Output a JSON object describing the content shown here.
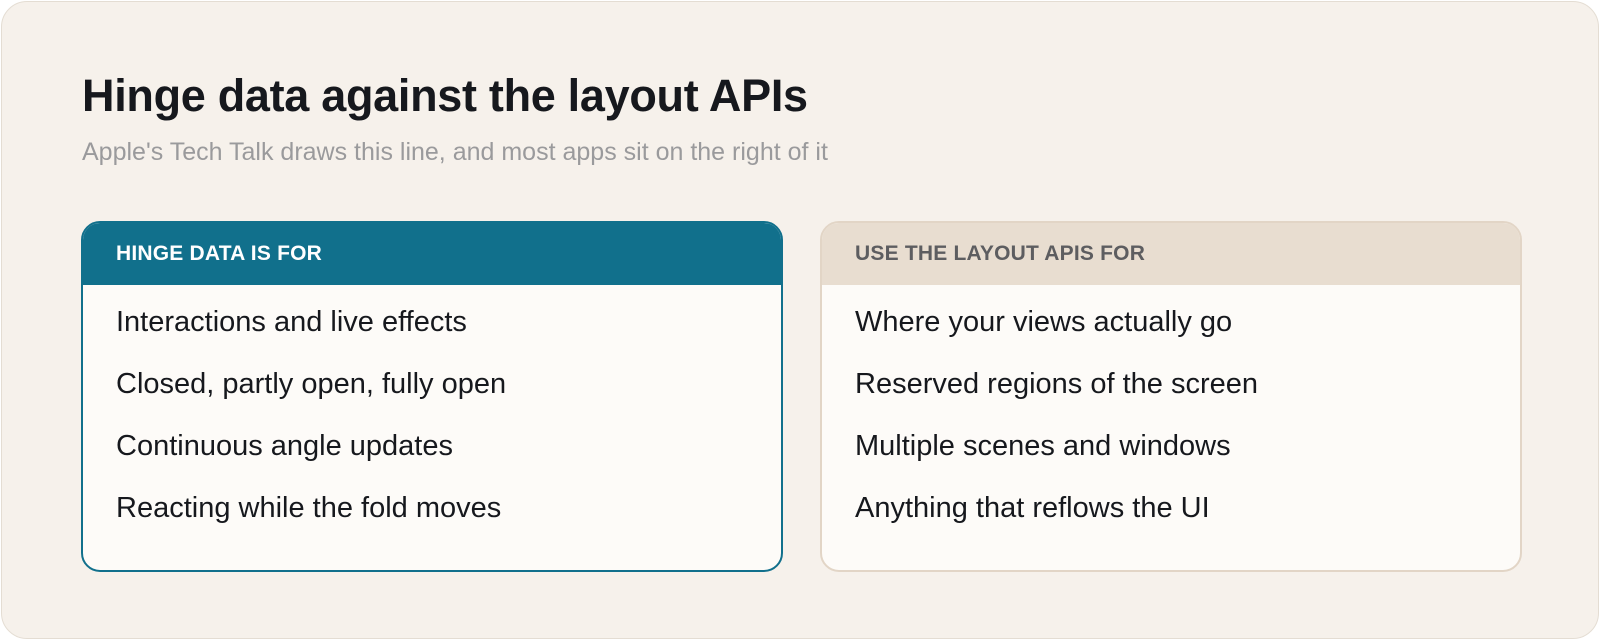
{
  "title": "Hinge data against the layout APIs",
  "subtitle": "Apple's Tech Talk draws this line, and most apps sit on the right of it",
  "colors": {
    "accent": "#11708c",
    "background": "#f6f1eb",
    "card_background": "#fdfbf8",
    "neutral_header": "#e8ddd0"
  },
  "cards": [
    {
      "header": "HINGE DATA IS FOR",
      "items": [
        "Interactions and live effects",
        "Closed, partly open, fully open",
        "Continuous angle updates",
        "Reacting while the fold moves"
      ]
    },
    {
      "header": "USE THE LAYOUT APIS FOR",
      "items": [
        "Where your views actually go",
        "Reserved regions of the screen",
        "Multiple scenes and windows",
        "Anything that reflows the UI"
      ]
    }
  ]
}
